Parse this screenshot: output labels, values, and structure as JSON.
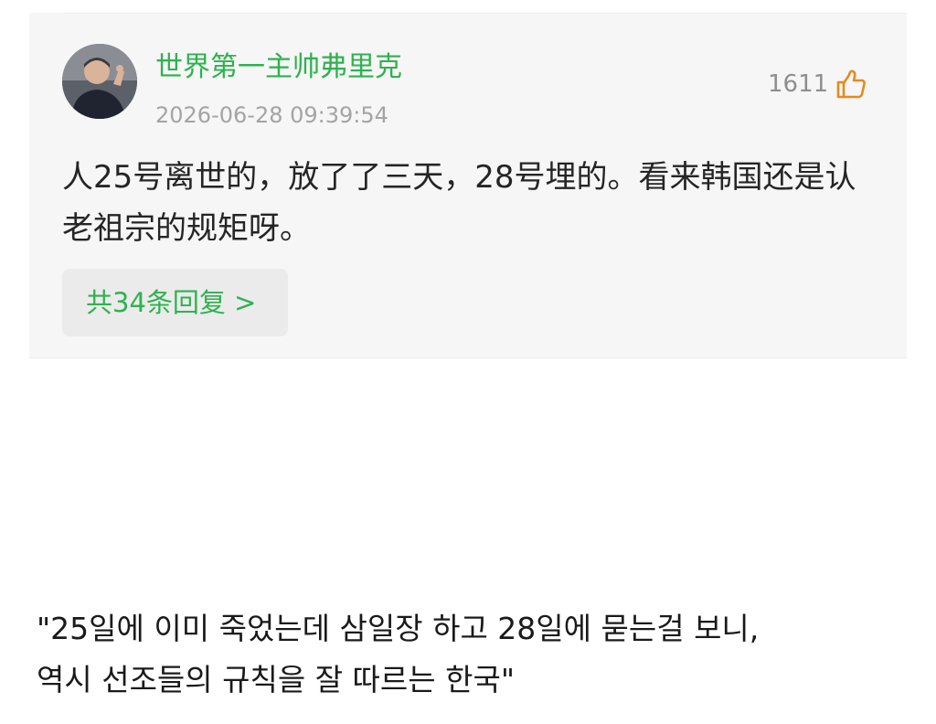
{
  "comment": {
    "author": "世界第一主帅弗里克",
    "timestamp": "2026-06-28 09:39:54",
    "likes": "1611",
    "text": "人25号离世的，放了了三天，28号埋的。看来韩国还是认老祖宗的规矩呀。",
    "replies_label": "共34条回复 >"
  },
  "caption": {
    "line1": "\"25일에 이미 죽었는데 삼일장 하고 28일에 묻는걸 보니,",
    "line2": "역시 선조들의 규칙을 잘 따르는 한국\""
  },
  "colors": {
    "accent_green": "#2fb14f",
    "card_bg": "#f6f6f6",
    "like_orange": "#e58a1f"
  },
  "icons": {
    "like": "thumbs-up-icon"
  }
}
